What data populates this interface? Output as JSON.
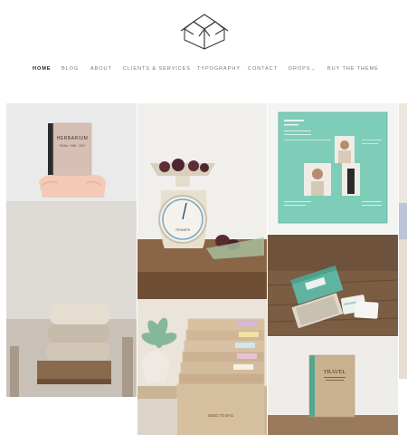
{
  "site": {
    "logo_icon": "folded-box-logo-icon"
  },
  "nav": {
    "items": [
      {
        "label": "Home",
        "active": true
      },
      {
        "label": "Blog"
      },
      {
        "label": "About"
      },
      {
        "label": "Clients & Services"
      },
      {
        "label": "Typography"
      },
      {
        "label": "Contact"
      },
      {
        "label": "Drops"
      },
      {
        "label": "Buy The Theme"
      }
    ],
    "dropdown_icon": "chevron-down-icon"
  },
  "portfolio": {
    "book": {
      "title": "HERBARIUM",
      "subtitle": "ROMA · MMI · 2012"
    },
    "notebook": {
      "title": "TRAVEL"
    },
    "pouch_label": "SEED TO BAG",
    "scale_brand": "TRIUMPH"
  },
  "colors": {
    "mint": "#7ecdb9",
    "mint_dark": "#5fb4a1",
    "wood": "#7b5d44",
    "accent_text": "#222222"
  }
}
